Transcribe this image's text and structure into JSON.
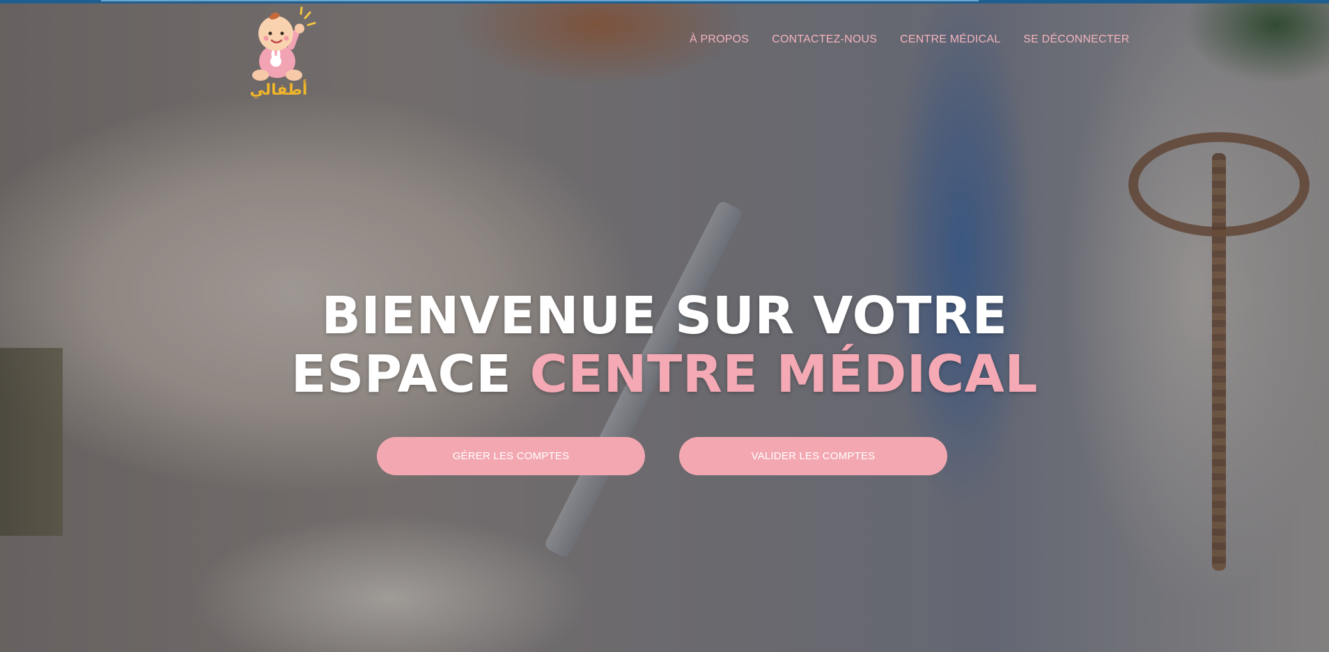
{
  "header": {
    "logo_text": "أطفالي",
    "nav": [
      {
        "label": "À PROPOS"
      },
      {
        "label": "CONTACTEZ-NOUS"
      },
      {
        "label": "CENTRE MÉDICAL"
      },
      {
        "label": "SE DÉCONNECTER"
      }
    ]
  },
  "hero": {
    "line1": "BIENVENUE SUR VOTRE",
    "line2_plain": "ESPACE ",
    "line2_accent": "CENTRE MÉDICAL",
    "buttons": [
      {
        "label": "GÉRER LES COMPTES"
      },
      {
        "label": "VALIDER LES COMPTES"
      }
    ]
  },
  "colors": {
    "accent_pink": "#f4a9b4",
    "button_pink": "#f3a8b1",
    "top_bar_blue": "#1f5f8f"
  }
}
